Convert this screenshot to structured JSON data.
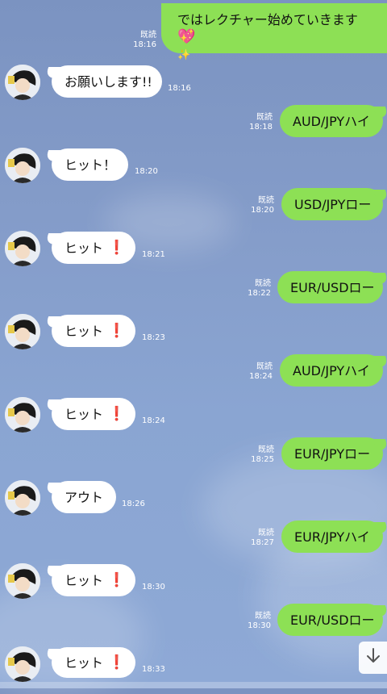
{
  "messages": [
    {
      "id": "m0",
      "side": "out",
      "text": "ではレクチャー始めていきます",
      "heart": "💖",
      "sparkle": "✨",
      "read": "既読",
      "time": "18:16"
    },
    {
      "id": "m1",
      "side": "in",
      "text": "お願いします!!",
      "time": "18:16"
    },
    {
      "id": "m2",
      "side": "out",
      "text": "AUD/JPYハイ",
      "read": "既読",
      "time": "18:18"
    },
    {
      "id": "m3",
      "side": "in",
      "text": "ヒット！",
      "time": "18:20"
    },
    {
      "id": "m4",
      "side": "out",
      "text": "USD/JPYロー",
      "read": "既読",
      "time": "18:20"
    },
    {
      "id": "m5",
      "side": "in",
      "text": "ヒット",
      "excl": "❗",
      "time": "18:21"
    },
    {
      "id": "m6",
      "side": "out",
      "text": "EUR/USDロー",
      "read": "既読",
      "time": "18:22"
    },
    {
      "id": "m7",
      "side": "in",
      "text": "ヒット",
      "excl": "❗",
      "time": "18:23"
    },
    {
      "id": "m8",
      "side": "out",
      "text": "AUD/JPYハイ",
      "read": "既読",
      "time": "18:24"
    },
    {
      "id": "m9",
      "side": "in",
      "text": "ヒット",
      "excl": "❗",
      "time": "18:24"
    },
    {
      "id": "m10",
      "side": "out",
      "text": "EUR/JPYロー",
      "read": "既読",
      "time": "18:25"
    },
    {
      "id": "m11",
      "side": "in",
      "text": "アウト",
      "time": "18:26"
    },
    {
      "id": "m12",
      "side": "out",
      "text": "EUR/JPYハイ",
      "read": "既読",
      "time": "18:27"
    },
    {
      "id": "m13",
      "side": "in",
      "text": "ヒット",
      "excl": "❗",
      "time": "18:30"
    },
    {
      "id": "m14",
      "side": "out",
      "text": "EUR/USDロー",
      "read": "既読",
      "time": "18:30"
    },
    {
      "id": "m15",
      "side": "in",
      "text": "ヒット",
      "excl": "❗",
      "time": "18:33"
    }
  ],
  "scroll_button": {
    "icon": "arrow-down-icon",
    "glyph": "↓"
  },
  "colors": {
    "outgoing_bubble": "#8de055",
    "incoming_bubble": "#ffffff",
    "background": "#859dca",
    "exclamation": "#d6262b"
  }
}
